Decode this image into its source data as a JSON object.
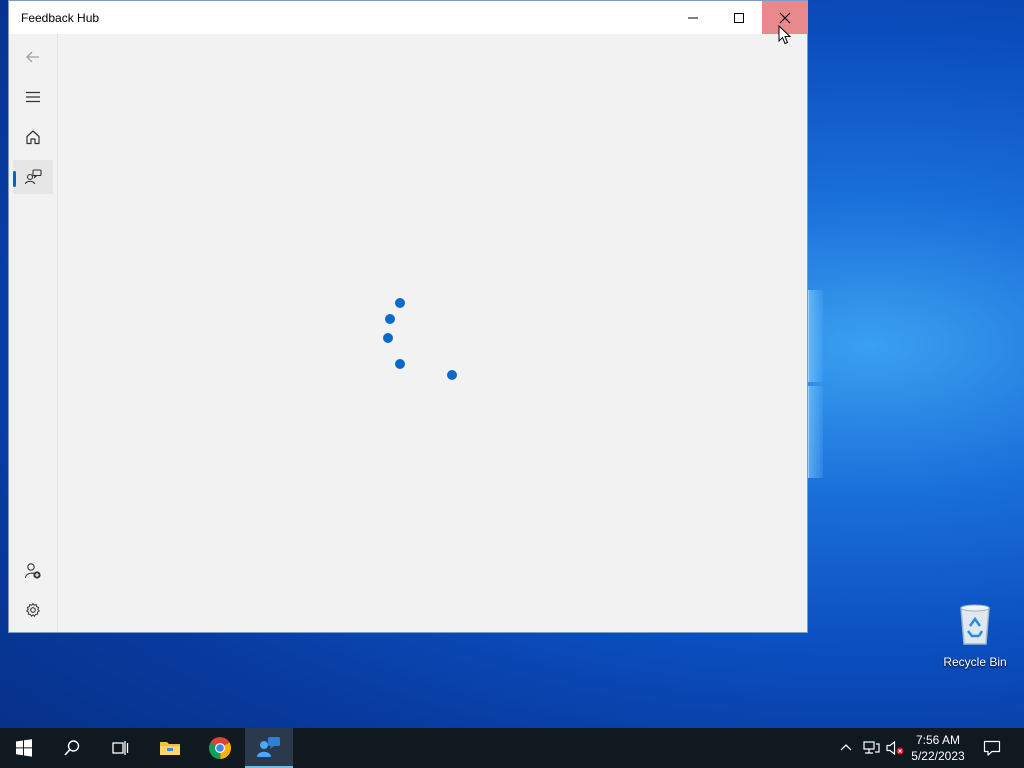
{
  "window": {
    "title": "Feedback Hub",
    "controls": {
      "minimize": "minimize-icon",
      "maximize": "maximize-icon",
      "close": "close-icon"
    }
  },
  "nav": {
    "items": [
      {
        "name": "back",
        "icon": "back-arrow-icon"
      },
      {
        "name": "menu",
        "icon": "hamburger-icon"
      },
      {
        "name": "home",
        "icon": "home-icon"
      },
      {
        "name": "feedback",
        "icon": "feedback-icon",
        "selected": true
      },
      {
        "name": "add-account",
        "icon": "add-person-icon"
      },
      {
        "name": "settings",
        "icon": "gear-icon"
      }
    ]
  },
  "loading": {
    "indicator": "progress-ring",
    "color": "#0a6ac9"
  },
  "desktop": {
    "recycle_bin_label": "Recycle Bin"
  },
  "taskbar": {
    "items": [
      "start-icon",
      "search-icon",
      "task-view-icon",
      "file-explorer-icon",
      "chrome-icon",
      "feedback-hub-icon"
    ],
    "clock_time": "7:56 AM",
    "clock_date": "5/22/2023"
  }
}
